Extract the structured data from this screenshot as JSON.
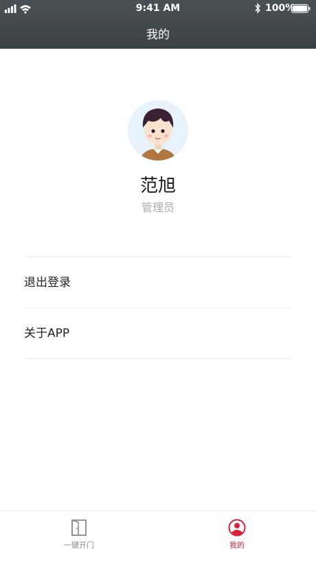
{
  "status_bar": {
    "time": "9:41 AM",
    "battery": "100%"
  },
  "header": {
    "title": "我的"
  },
  "profile": {
    "name": "范旭",
    "role": "管理员"
  },
  "menu": {
    "items": [
      {
        "label": "退出登录"
      },
      {
        "label": "关于APP"
      }
    ]
  },
  "tabbar": {
    "tabs": [
      {
        "label": "一键开门",
        "icon": "door-icon",
        "active": false
      },
      {
        "label": "我的",
        "icon": "user-circle-icon",
        "active": true
      }
    ]
  },
  "colors": {
    "nav_bg": "#424a4d",
    "accent": "#d6243c",
    "tab_inactive": "#8a8a8a"
  }
}
